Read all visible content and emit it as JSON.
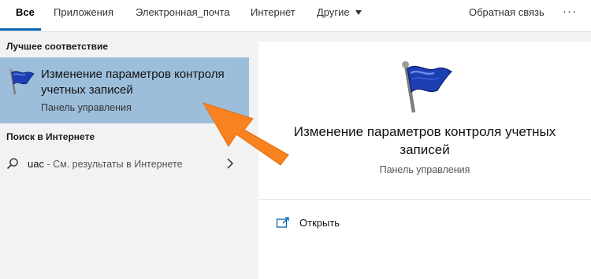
{
  "tabs": {
    "all": "Все",
    "apps": "Приложения",
    "email": "Электронная_почта",
    "web": "Интернет",
    "other": "Другие",
    "feedback": "Обратная связь",
    "more": "···"
  },
  "results": {
    "best_match_header": "Лучшее соответствие",
    "best_match": {
      "title": "Изменение параметров контроля учетных записей",
      "subtitle": "Панель управления",
      "icon": "flag-icon"
    },
    "web_header": "Поиск в Интернете",
    "web_search": {
      "query": "uac",
      "suffix": " - См. результаты в Интернете"
    }
  },
  "detail": {
    "title": "Изменение параметров контроля учетных записей",
    "subtitle": "Панель управления",
    "open_label": "Открыть"
  },
  "colors": {
    "accent": "#0063b1",
    "selection": "#9dbedb",
    "annotation_arrow": "#f7821f"
  }
}
